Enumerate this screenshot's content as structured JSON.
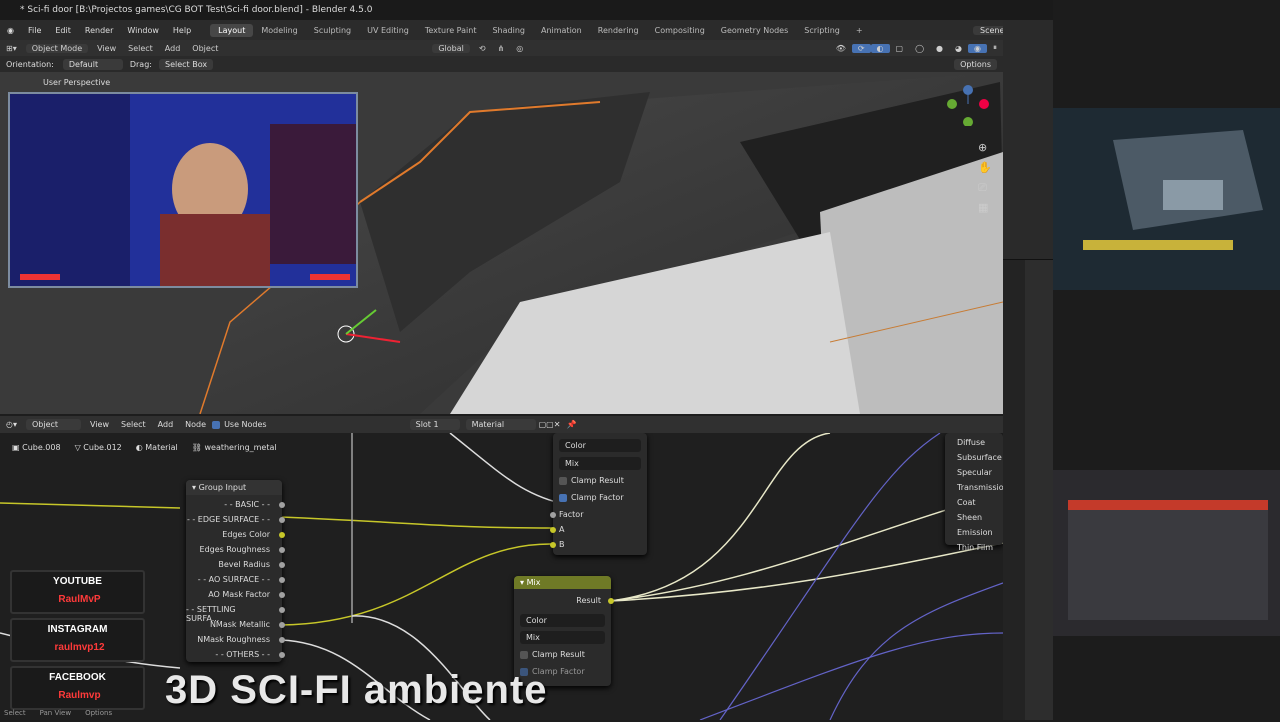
{
  "window": {
    "title": "* Sci-fi door [B:\\Projectos games\\CG BOT Test\\Sci-fi door.blend] - Blender 4.5.0"
  },
  "menu": [
    "File",
    "Edit",
    "Render",
    "Window",
    "Help"
  ],
  "workspaces": [
    "Layout",
    "Modeling",
    "Sculpting",
    "UV Editing",
    "Texture Paint",
    "Shading",
    "Animation",
    "Rendering",
    "Compositing",
    "Geometry Nodes",
    "Scripting"
  ],
  "active_workspace": "Layout",
  "scene_label": "Scene",
  "viewport_header": {
    "mode": "Object Mode",
    "menus": [
      "View",
      "Select",
      "Add",
      "Object"
    ],
    "transform": "Global"
  },
  "viewport_header2": {
    "orientation_label": "Orientation:",
    "orientation": "Default",
    "drag_label": "Drag:",
    "drag": "Select Box",
    "options": "Options"
  },
  "viewport": {
    "perspective": "User Perspective"
  },
  "node_header": {
    "editor": "Object",
    "menus": [
      "View",
      "Select",
      "Add",
      "Node"
    ],
    "use_nodes": "Use Nodes",
    "slot": "Slot 1",
    "material": "Material"
  },
  "breadcrumb": [
    "Cube.008",
    "Cube.012",
    "Material",
    "weathering_metal"
  ],
  "group_input": {
    "title": "Group Input",
    "outputs": [
      "- - BASIC - -",
      "- - EDGE SURFACE - -",
      "Edges Color",
      "Edges Roughness",
      "Bevel Radius",
      "- - AO SURFACE - -",
      "AO Mask Factor",
      "- - SETTLING SURFA...",
      "NMask Metallic",
      "NMask Roughness",
      "- - OTHERS - -"
    ]
  },
  "mix_top": {
    "type": "Color",
    "blend": "Mix",
    "clamp_result": "Clamp Result",
    "clamp_factor": "Clamp Factor",
    "factor": "Factor",
    "a": "A",
    "b": "B"
  },
  "mix_node": {
    "title": "Mix",
    "result": "Result",
    "type": "Color",
    "blend": "Mix",
    "clamp_result": "Clamp Result",
    "clamp_factor": "Clamp Factor"
  },
  "bsdf_panels": [
    "Diffuse",
    "Subsurface",
    "Specular",
    "Transmission",
    "Coat",
    "Sheen",
    "Emission",
    "Thin Film"
  ],
  "social": [
    {
      "network": "YOUTUBE",
      "handle": "RaulMvP"
    },
    {
      "network": "INSTAGRAM",
      "handle": "raulmvp12"
    },
    {
      "network": "FACEBOOK",
      "handle": "Raulmvp"
    }
  ],
  "overlay_title": "3D SCI-FI ambiente",
  "status_bar": [
    "Select",
    "Pan View",
    "Options"
  ],
  "colors": {
    "accent": "#4772b3",
    "yellow_socket": "#c7c729",
    "gray_socket": "#a1a1a1",
    "mix_header": "#6f7a26",
    "brand_red": "#ff3a3a"
  }
}
